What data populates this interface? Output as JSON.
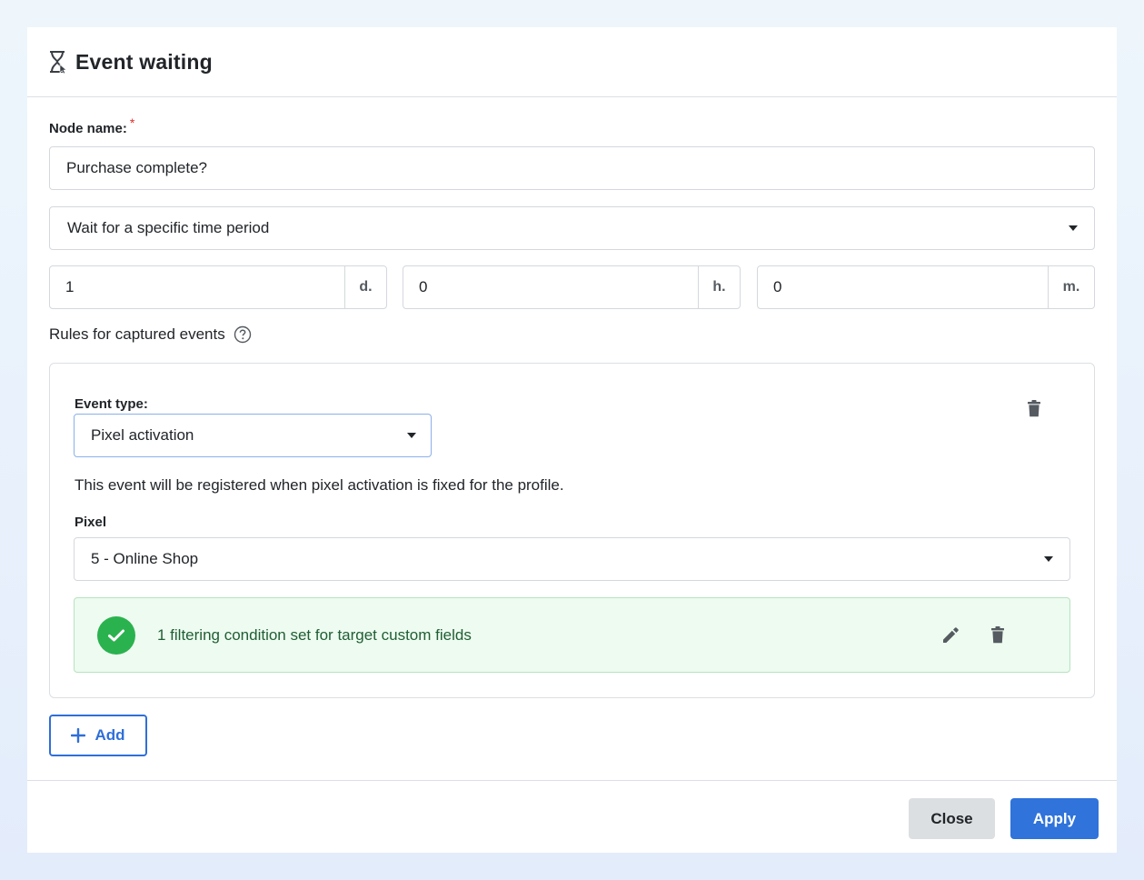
{
  "dialog": {
    "title": "Event waiting",
    "icon": "hourglass-icon"
  },
  "node_name": {
    "label": "Node name:",
    "required_mark": "*",
    "value": "Purchase complete?"
  },
  "wait_mode": {
    "selected": "Wait for a specific time period"
  },
  "duration": {
    "days": {
      "value": "1",
      "unit": "d."
    },
    "hours": {
      "value": "0",
      "unit": "h."
    },
    "minutes": {
      "value": "0",
      "unit": "m."
    }
  },
  "rules": {
    "title": "Rules for captured events",
    "help_icon": "question-circle-icon",
    "event_type_label": "Event type:",
    "event_type_selected": "Pixel activation",
    "description": "This event will be registered when pixel activation is fixed for the profile.",
    "pixel_label": "Pixel",
    "pixel_selected": "5 - Online Shop",
    "filter_status": "1 filtering condition set for target custom fields"
  },
  "actions": {
    "add_label": "Add",
    "close_label": "Close",
    "apply_label": "Apply"
  },
  "colors": {
    "accent": "#2f73db",
    "success": "#2ab24f",
    "success_bg": "#eefbf0"
  }
}
